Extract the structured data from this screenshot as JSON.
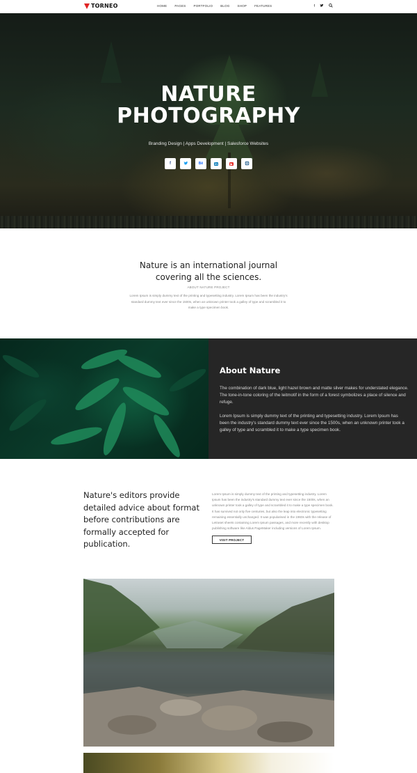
{
  "nav": {
    "logo": "TORNEO",
    "menu": [
      "HOME",
      "PAGES",
      "PORTFOLIO",
      "BLOG",
      "SHOP",
      "FEATURES"
    ],
    "icons": [
      "facebook-icon",
      "twitter-icon",
      "search-icon"
    ]
  },
  "hero": {
    "title_line1": "NATURE",
    "title_line2": "PHOTOGRAPHY",
    "subtitle": "Branding Design | Apps Development | Salesforce Websites",
    "social": [
      {
        "icon": "facebook-icon",
        "glyph": "f",
        "color": "#3b5998"
      },
      {
        "icon": "twitter-icon",
        "glyph": "t",
        "color": "#1da1f2"
      },
      {
        "icon": "behance-icon",
        "glyph": "Bē",
        "color": "#1769ff"
      },
      {
        "icon": "linkedin-icon",
        "glyph": "in",
        "color": "#0077b5"
      },
      {
        "icon": "youtube-icon",
        "glyph": "▶",
        "color": "#e52d27"
      },
      {
        "icon": "instagram-icon",
        "glyph": "◎",
        "color": "#3f729b"
      }
    ]
  },
  "intro": {
    "title_line1": "Nature is an international journal",
    "title_line2": "covering all the sciences.",
    "label": "ABOUT NATURE PROJECT",
    "text": "Lorem Ipsum is simply dummy text of the printing and typesetting industry. Lorem Ipsum has been the industry's standard dummy text ever since the 1500s, when an unknown printer took a galley of type and scrambled it to make a type specimen book."
  },
  "about": {
    "title": "About Nature",
    "p1": "The combination of dark blue, light hazel brown and matte silver makes for understated elegance. The tone-in-tone coloring of the leitmotif in the form of a forest symbolizes a place of silence and refuge.",
    "p2": "Lorem Ipsum is simply dummy text of the printing and typesetting industry. Lorem Ipsum has been the industry's standard dummy text ever since the 1500s, when an unknown printer took a galley of type and scrambled it to make a type specimen book."
  },
  "editors": {
    "title": "Nature's editors provide detailed advice about format before contributions are formally accepted for publication.",
    "text": "Lorem Ipsum is simply dummy text of the printing and typesetting industry. Lorem Ipsum has been the industry's standard dummy text ever since the 1500s, when an unknown printer took a galley of type and scrambled it to make a type specimen book. It has survived not only five centuries, but also the leap into electronic typesetting remaining essentially unchanged. It was popularised in the 1960s with the release of Letraset sheets containing Lorem Ipsum passages, and more recently with desktop publishing software like Aldus PageMaker including versions of Lorem Ipsum.",
    "button": "VISIT PROJECT"
  },
  "colors": {
    "accent": "#e02424",
    "dark_panel": "#262626"
  }
}
